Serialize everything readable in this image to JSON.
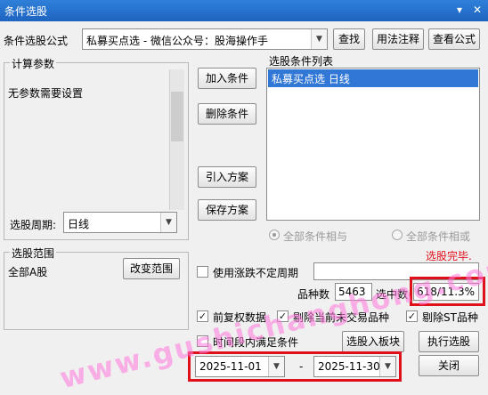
{
  "window": {
    "title": "条件选股",
    "close_glyph": "✕",
    "pin_glyph": "▾"
  },
  "formula": {
    "label": "条件选股公式",
    "selected": "私募买点选  -  微信公众号：股海操作手",
    "find_button": "查找",
    "usage_button": "用法注释",
    "view_button": "查看公式"
  },
  "params": {
    "legend": "计算参数",
    "message": "无参数需要设置",
    "period_label": "选股周期:",
    "period_value": "日线"
  },
  "actions": {
    "add": "加入条件",
    "delete": "删除条件",
    "import": "引入方案",
    "save": "保存方案"
  },
  "conditions": {
    "legend": "选股条件列表",
    "items": [
      "私募买点选  日线"
    ],
    "radio_and": "全部条件相与",
    "radio_or": "全部条件相或"
  },
  "status": {
    "text": "选股完毕.",
    "color": "#e0101b"
  },
  "range": {
    "legend": "选股范围",
    "value": "全部A股",
    "change_button": "改变范围"
  },
  "options": {
    "variable_period": "使用涨跌不定周期",
    "variable_period_value": "",
    "count_label": "品种数",
    "count_value": "5463",
    "selected_label": "选中数",
    "selected_value": "618/11.3%",
    "pre_adjust": "前复权数据",
    "exclude_untraded": "剔除当前未交易品种",
    "exclude_st": "剔除ST品种",
    "time_range": "时间段内满足条件",
    "check_glyph": "✓"
  },
  "bottom": {
    "to_block_button": "选股入板块",
    "execute_button": "执行选股",
    "date_start": "2025-11-01",
    "date_sep": "-",
    "date_end": "2025-11-30",
    "close_button": "关闭"
  },
  "overlay": {
    "watermark": "www.gushichanghong.com"
  },
  "colors": {
    "titlebar": "#1e64c0",
    "list_selected": "#3077d6",
    "highlight_box": "#e0101b"
  }
}
